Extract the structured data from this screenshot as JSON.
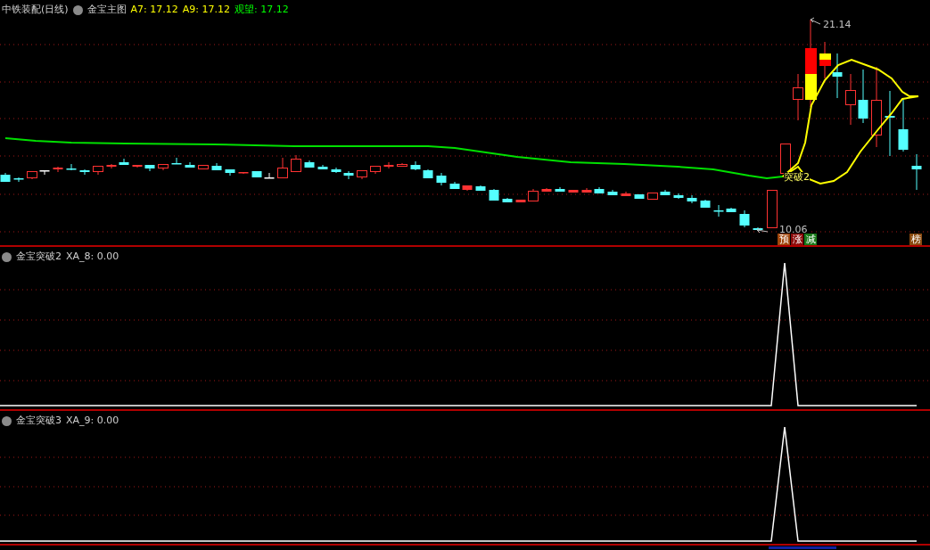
{
  "main_panel": {
    "stock": "中铁装配(日线)",
    "indicator": "金宝主图",
    "values": [
      {
        "label": "A7: 17.12",
        "color": "#ffff00"
      },
      {
        "label": "A9: 17.12",
        "color": "#ffff00"
      },
      {
        "label": "观望: 17.12",
        "color": "#00ff00"
      }
    ],
    "high_label": "21.14",
    "low_label": "10.06",
    "signal_label": "突破2",
    "badges": [
      {
        "text": "预",
        "color": "#a0450a"
      },
      {
        "text": "涨",
        "color": "#8b0a0a"
      },
      {
        "text": "减",
        "color": "#1a7a1a"
      },
      {
        "text": "榜",
        "color": "#8a4a10"
      }
    ]
  },
  "sub_panels": [
    {
      "name": "金宝突破2",
      "value": "XA_8: 0.00"
    },
    {
      "name": "金宝突破3",
      "value": "XA_9: 0.00"
    }
  ]
}
